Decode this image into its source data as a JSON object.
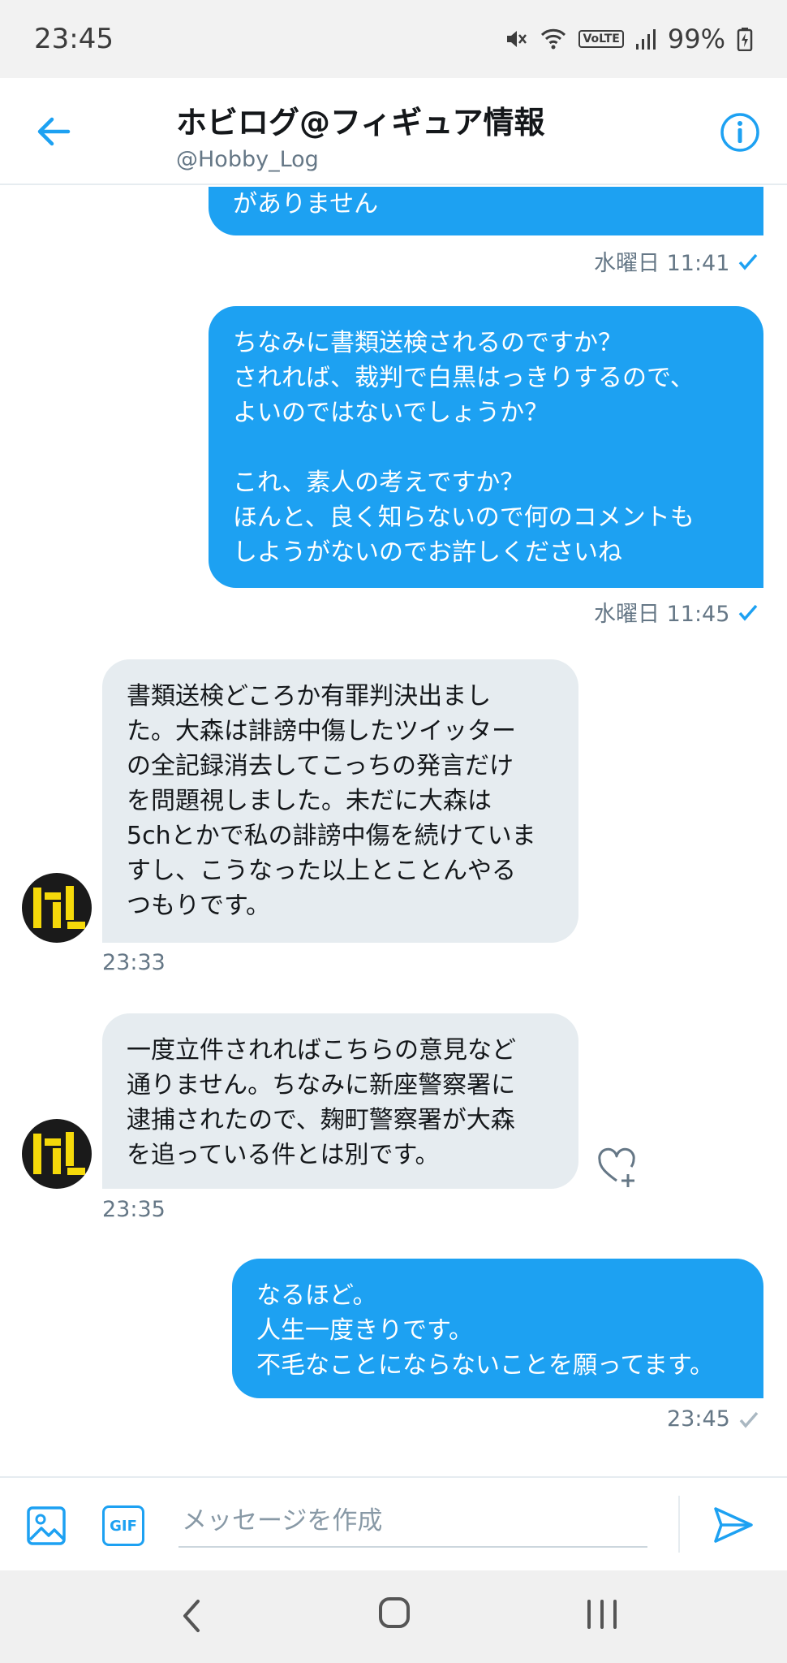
{
  "status_bar": {
    "time": "23:45",
    "battery": "99%",
    "network_label": "VoLTE",
    "icons": [
      "mute-icon",
      "wifi-icon",
      "volte-icon",
      "signal-icon",
      "battery-charging-icon"
    ]
  },
  "header": {
    "title": "ホビログ@フィギュア情報",
    "handle": "@Hobby_Log",
    "back_icon": "arrow-left-icon",
    "info_icon": "info-icon"
  },
  "messages": [
    {
      "direction": "sent",
      "lines": [
        "がありません"
      ],
      "time": "水曜日 11:41",
      "status_icon": "check-icon"
    },
    {
      "direction": "sent",
      "lines": [
        "ちなみに書類送検されるのですか？",
        "されれば、裁判で白黒はっきりするので、",
        "よいのではないでしょうか？",
        "",
        "これ、素人の考えですか？",
        "ほんと、良く知らないので何のコメントも",
        "しようがないのでお許しくださいね"
      ],
      "time": "水曜日 11:45",
      "status_icon": "check-icon"
    },
    {
      "direction": "received",
      "lines": [
        "書類送検どころか有罪判決出まし",
        "た。大森は誹謗中傷したツイッター",
        "の全記録消去してこっちの発言だけ",
        "を問題視しました。未だに大森は",
        "5chとかで私の誹謗中傷を続けていま",
        "すし、こうなった以上とことんやる",
        "つもりです。"
      ],
      "time": "23:33"
    },
    {
      "direction": "received",
      "lines": [
        "一度立件されればこちらの意見など",
        "通りません。ちなみに新座警察署に",
        "逮捕されたので、麹町警察署が大森",
        "を追っている件とは別です。"
      ],
      "time": "23:35",
      "reaction_icon": "heart-plus-icon"
    },
    {
      "direction": "sent",
      "lines": [
        "なるほど。",
        "人生一度きりです。",
        "不毛なことにならないことを願ってます。"
      ],
      "time": "23:45",
      "status_icon": "check-icon"
    }
  ],
  "composer": {
    "placeholder": "メッセージを作成",
    "gif_label": "GIF",
    "media_icon": "image-icon",
    "send_icon": "send-icon"
  },
  "colors": {
    "accent": "#1da1f2",
    "bubble_received": "#e6ecf0",
    "meta_text": "#657786",
    "avatar_yellow": "#f5d90a"
  }
}
